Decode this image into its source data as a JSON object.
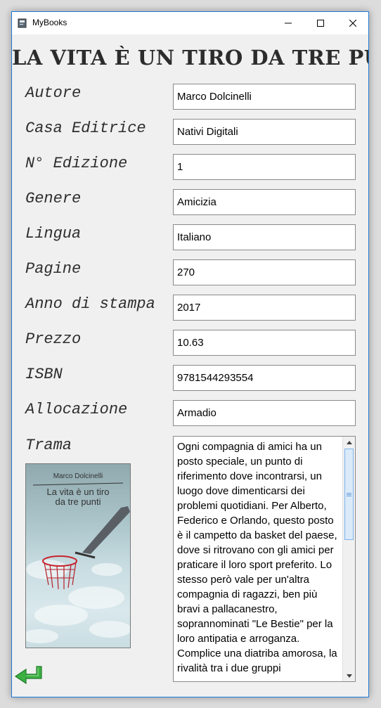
{
  "window": {
    "title": "MyBooks"
  },
  "book": {
    "title": "La vita è un tiro da tre punti",
    "fields": [
      {
        "label": "Autore",
        "value": "Marco Dolcinelli"
      },
      {
        "label": "Casa Editrice",
        "value": "Nativi Digitali"
      },
      {
        "label": "N° Edizione",
        "value": "1"
      },
      {
        "label": "Genere",
        "value": "Amicizia"
      },
      {
        "label": "Lingua",
        "value": "Italiano"
      },
      {
        "label": "Pagine",
        "value": "270"
      },
      {
        "label": "Anno di stampa",
        "value": "2017"
      },
      {
        "label": "Prezzo",
        "value": "10.63"
      },
      {
        "label": "ISBN",
        "value": "9781544293554"
      },
      {
        "label": "Allocazione",
        "value": "Armadio"
      }
    ],
    "plot_label": "Trama",
    "plot": "Ogni compagnia di amici ha un posto speciale, un punto di riferimento dove incontrarsi, un luogo dove dimenticarsi dei problemi quotidiani. Per Alberto, Federico e Orlando, questo posto è il campetto da basket del paese, dove si ritrovano con gli amici per praticare il loro sport preferito. Lo stesso però vale per un'altra compagnia di ragazzi, ben più bravi a pallacanestro, soprannominati \"Le Bestie\" per la loro antipatia e arroganza. Complice una diatriba amorosa, la rivalità tra i due gruppi",
    "cover": {
      "author": "Marco Dolcinelli",
      "title_line1": "La vita è un tiro",
      "title_line2": "da tre punti"
    }
  },
  "icons": {
    "app": "book-icon",
    "minimize": "minimize-icon",
    "maximize": "maximize-icon",
    "close": "close-icon",
    "back": "back-arrow-icon"
  },
  "colors": {
    "title_text": "#2c2c2c",
    "back_arrow": "#3cb043",
    "scroll_thumb": "#dbeaf9"
  }
}
